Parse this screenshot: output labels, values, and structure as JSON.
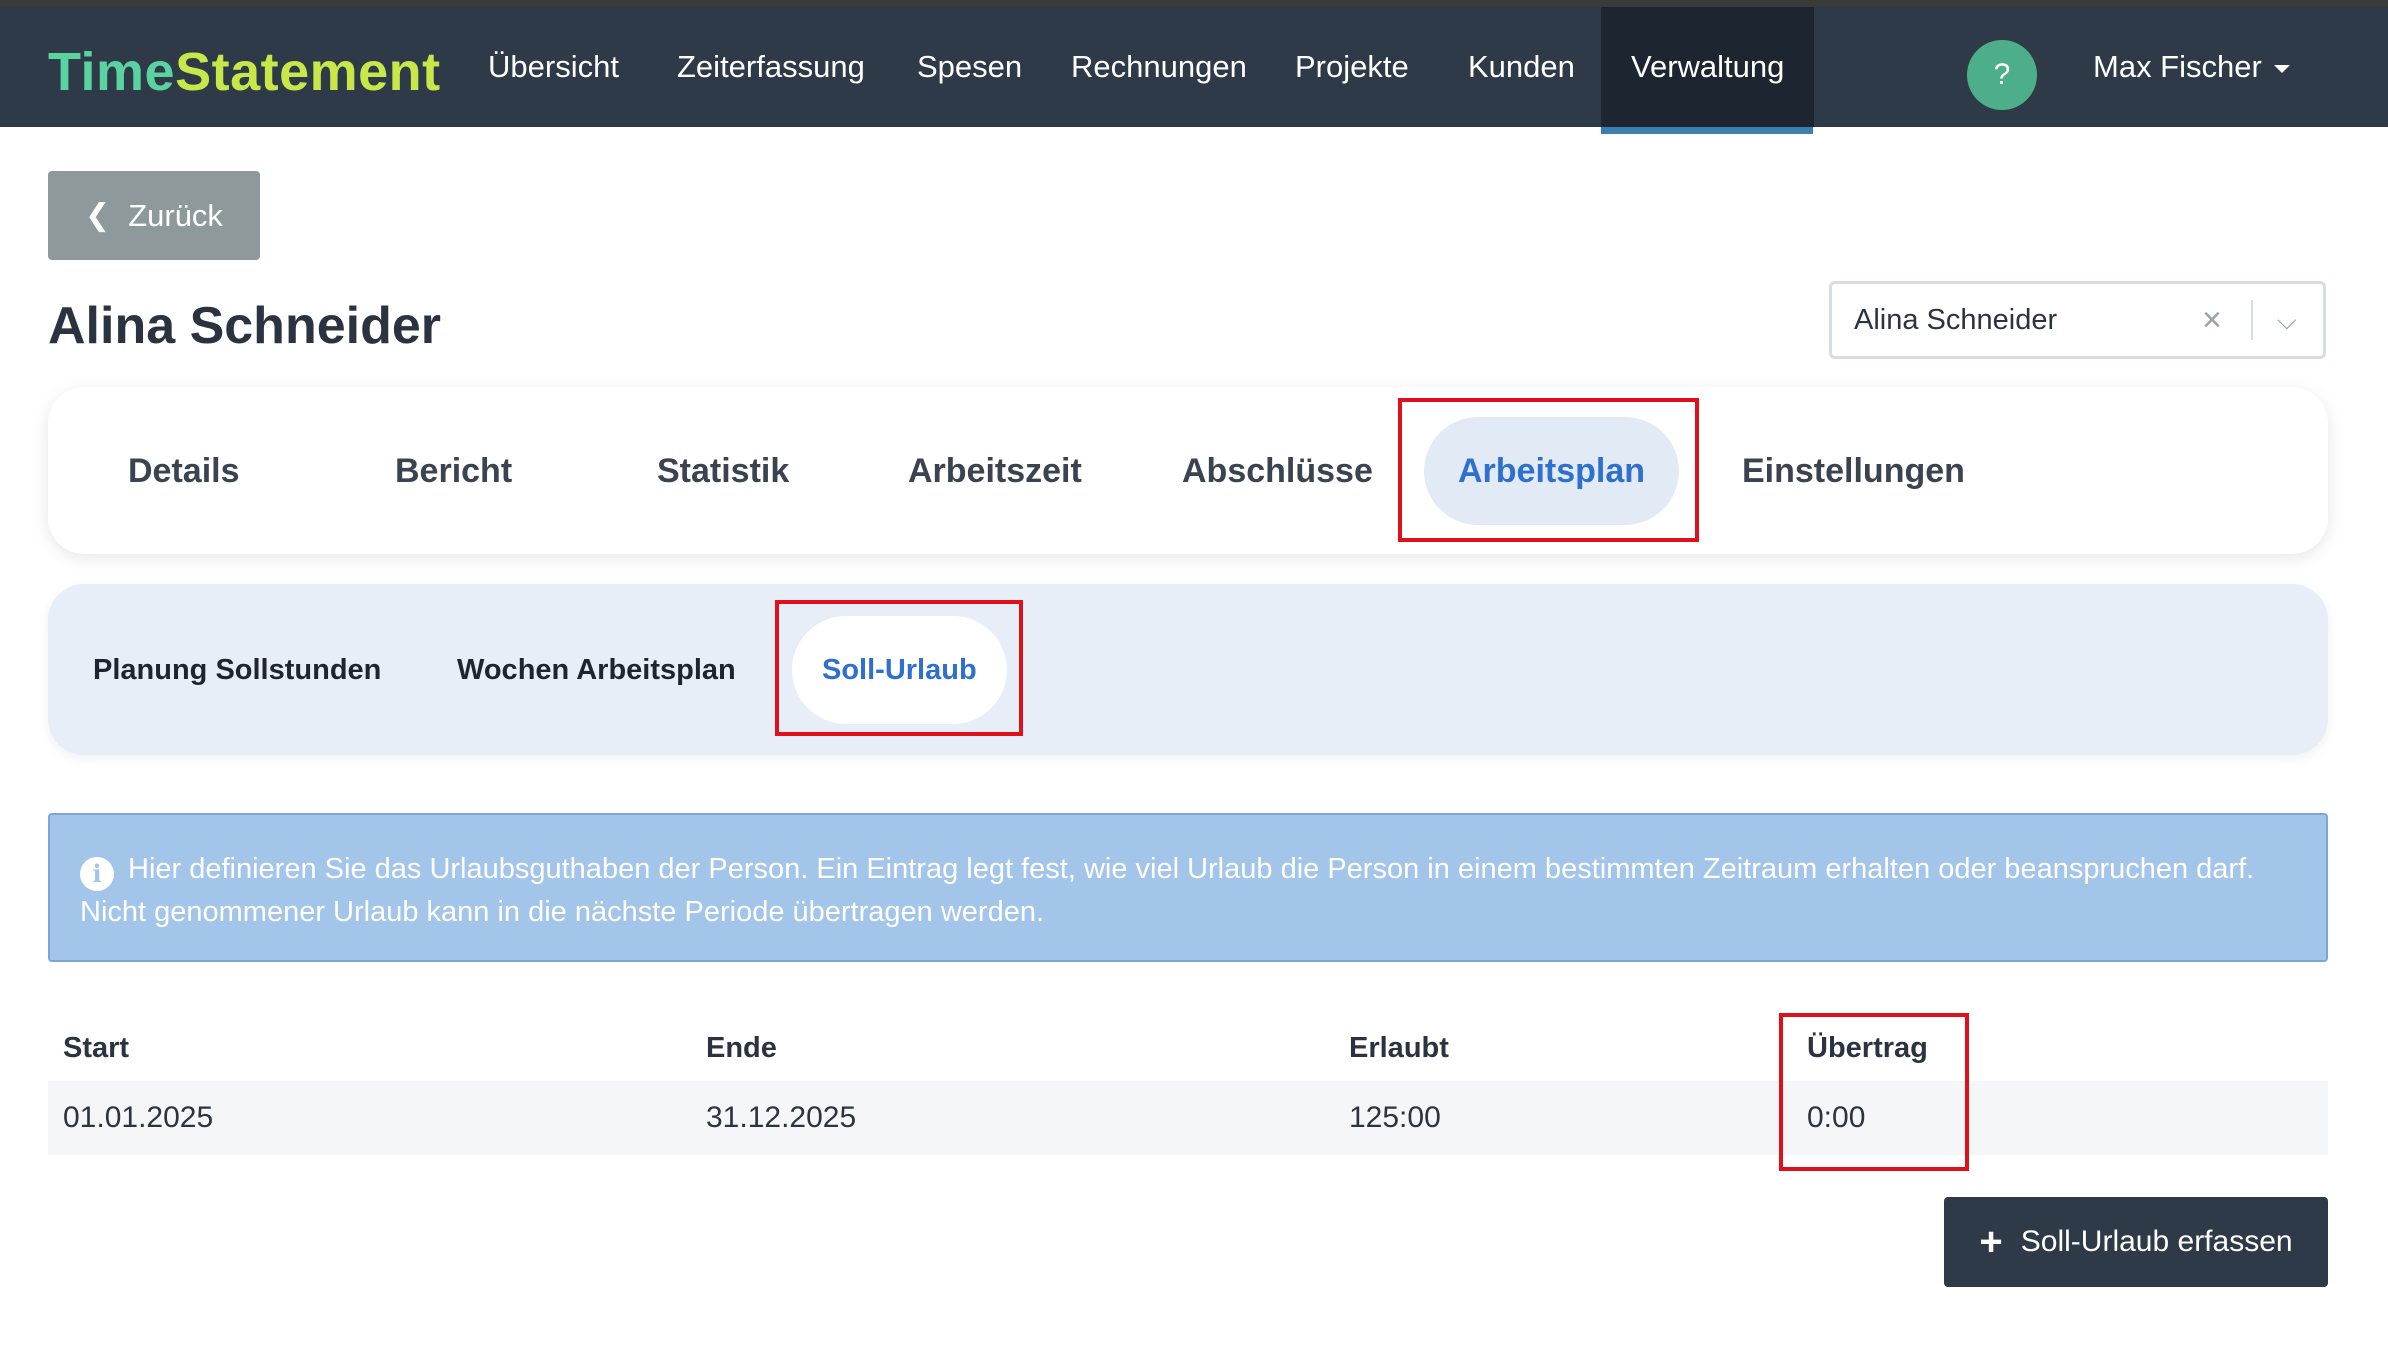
{
  "navbar": {
    "brand_part1": "Time",
    "brand_part2": "Statement",
    "items": [
      {
        "label": "Übersicht"
      },
      {
        "label": "Zeiterfassung"
      },
      {
        "label": "Spesen"
      },
      {
        "label": "Rechnungen"
      },
      {
        "label": "Projekte"
      },
      {
        "label": "Kunden"
      },
      {
        "label": "Verwaltung",
        "active": true
      }
    ],
    "help_label": "?",
    "user_name": "Max Fischer"
  },
  "back_button": {
    "label": "Zurück"
  },
  "page_title": "Alina Schneider",
  "person_select": {
    "value": "Alina Schneider",
    "clear_glyph": "×",
    "arrow_glyph": "⌵"
  },
  "tabs": [
    {
      "label": "Details"
    },
    {
      "label": "Bericht"
    },
    {
      "label": "Statistik"
    },
    {
      "label": "Arbeitszeit"
    },
    {
      "label": "Abschlüsse"
    },
    {
      "label": "Arbeitsplan",
      "active": true
    },
    {
      "label": "Einstellungen"
    }
  ],
  "subtabs": [
    {
      "label": "Planung Sollstunden"
    },
    {
      "label": "Wochen Arbeitsplan"
    },
    {
      "label": "Soll-Urlaub",
      "active": true
    }
  ],
  "info": {
    "icon_glyph": "i",
    "line1": "Hier definieren Sie das Urlaubsguthaben der Person. Ein Eintrag legt fest, wie viel Urlaub die Person in einem bestimmten Zeitraum erhalten oder beanspruchen darf.",
    "line2": "Nicht genommener Urlaub kann in die nächste Periode übertragen werden."
  },
  "table": {
    "columns": [
      "Start",
      "Ende",
      "Erlaubt",
      "Übertrag"
    ],
    "rows": [
      [
        "01.01.2025",
        "31.12.2025",
        "125:00",
        "0:00"
      ]
    ]
  },
  "add_button": {
    "icon_glyph": "+",
    "label": "Soll-Urlaub erfassen"
  },
  "colors": {
    "navbar_bg": "#2e3a48",
    "brand_green": "#5bd3a0",
    "brand_lime": "#c8e84a",
    "accent_blue": "#2f6fce",
    "highlight_red": "#e0101a",
    "info_bg": "#a3c5ea"
  }
}
